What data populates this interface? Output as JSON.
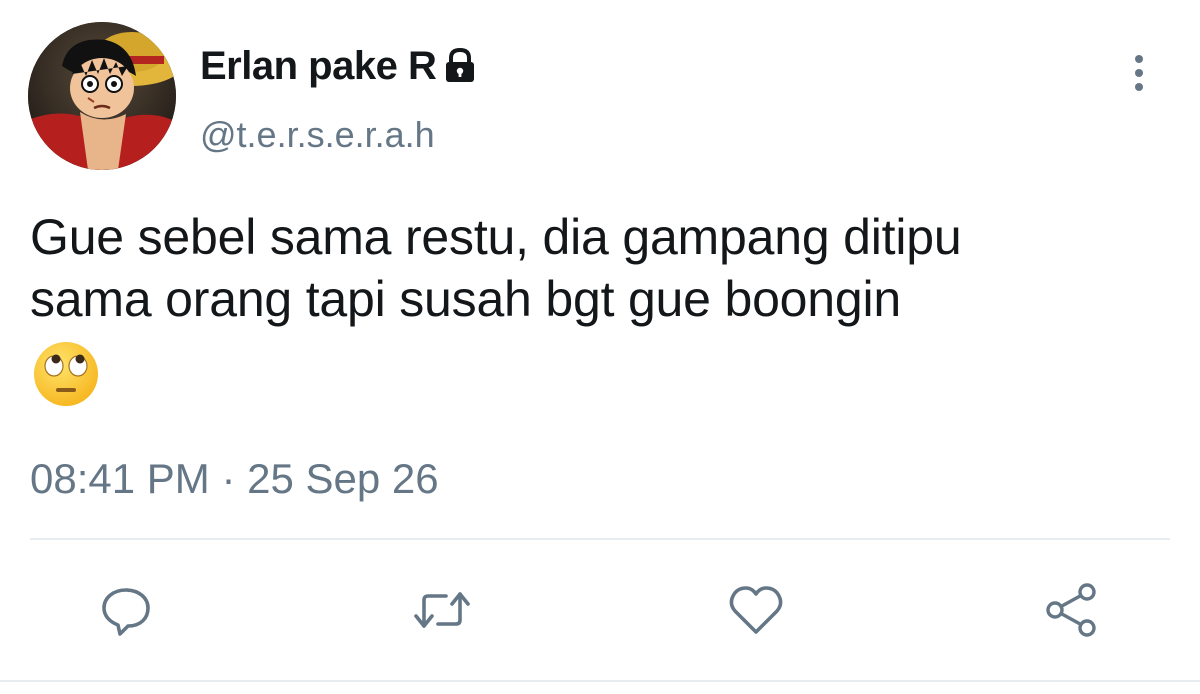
{
  "author": {
    "display_name": "Erlan pake R",
    "handle": "@t.e.r.s.e.r.a.h",
    "avatar_icon": "avatar-icon",
    "protected_icon": "lock-icon"
  },
  "tweet": {
    "text": "Gue sebel sama restu, dia gampang ditipu\nsama orang tapi susah bgt gue boongin",
    "emoji_icon": "face-with-rolling-eyes-icon",
    "timestamp": "08:41 PM · 25 Sep 26"
  },
  "actions": {
    "items": [
      "reply-icon",
      "retweet-icon",
      "like-icon",
      "share-icon"
    ]
  },
  "colors": {
    "text_primary": "#14171a",
    "text_secondary": "#657786",
    "icon": "#657786",
    "divider": "#e6ecf0"
  }
}
